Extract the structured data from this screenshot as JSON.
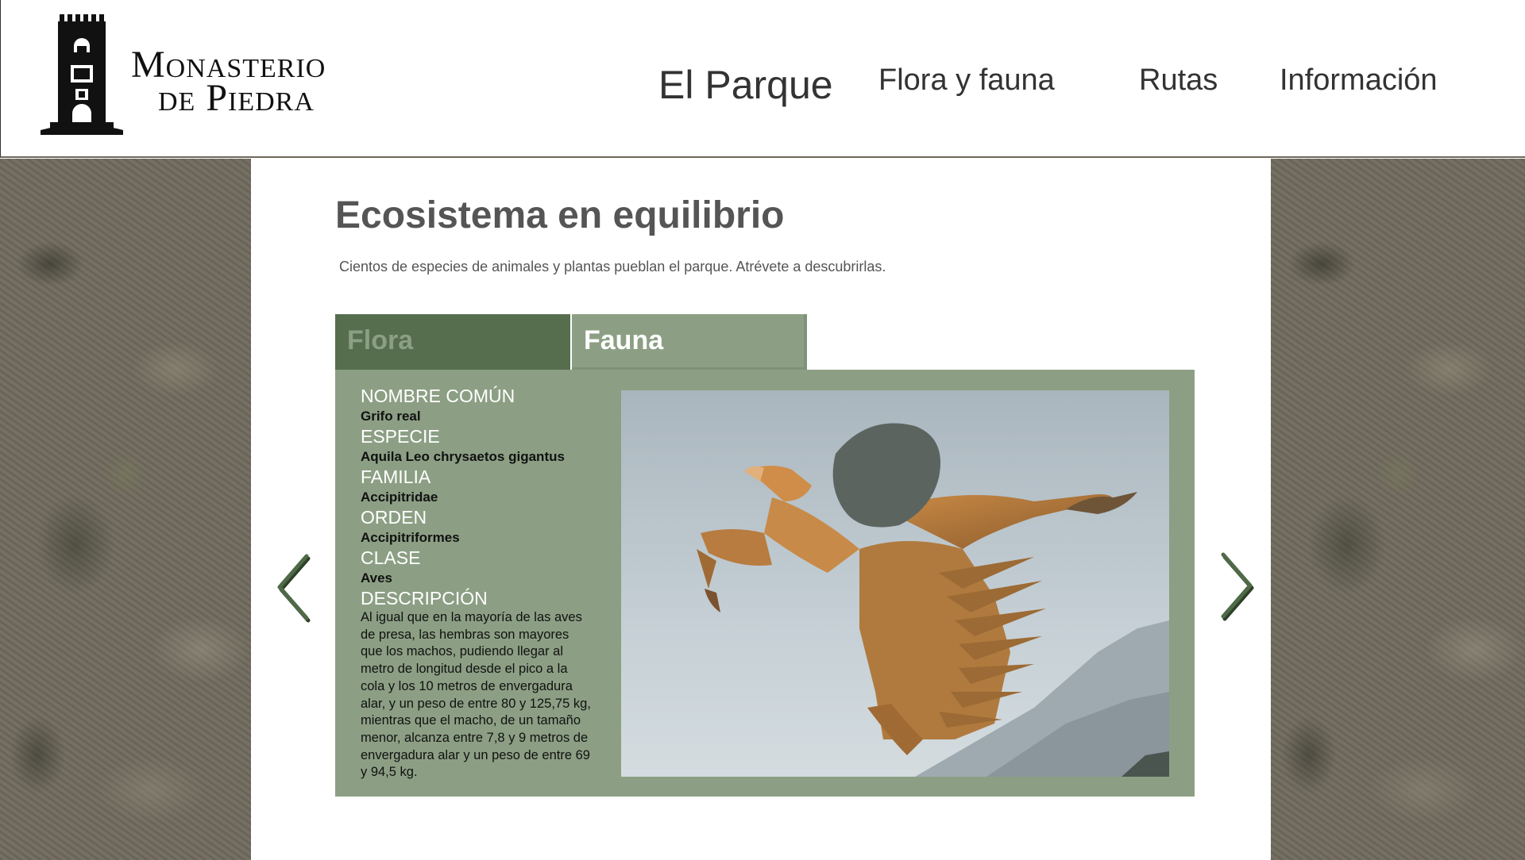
{
  "header": {
    "logo_line1": "Monasterio",
    "logo_line2": "de Piedra",
    "nav": [
      {
        "label": "El Parque"
      },
      {
        "label": "Flora y fauna"
      },
      {
        "label": "Rutas"
      },
      {
        "label": "Información"
      }
    ]
  },
  "main": {
    "title": "Ecosistema en equilibrio",
    "subtitle": "Cientos de especies de animales y plantas pueblan el parque. Atrévete a descubrirlas.",
    "tabs": [
      {
        "label": "Flora",
        "active": false
      },
      {
        "label": "Fauna",
        "active": true
      }
    ],
    "species": {
      "common_name_label": "NOMBRE COMÚN",
      "common_name": "Grifo real",
      "species_label": "ESPECIE",
      "species": "Aquila Leo chrysaetos gigantus",
      "family_label": "FAMILIA",
      "family": "Accipitridae",
      "order_label": "ORDEN",
      "order": "Accipitriformes",
      "class_label": "CLASE",
      "class": "Aves",
      "description_label": "DESCRIPCIÓN",
      "description": "Al igual que en la mayoría de las aves de presa, las hembras son mayores que los machos, pudiendo llegar al metro de longitud desde el pico a la cola y los 10 metros de envergadura alar, y un peso de entre 80 y 125,75 kg, mientras que el macho, de un tamaño menor, alcanza entre 7,8 y 9 metros de envergadura alar y un peso de entre 69 y 94,5 kg."
    }
  },
  "icons": {
    "prev": "chevron-left-icon",
    "next": "chevron-right-icon"
  },
  "colors": {
    "tab_dark": "#566e4d",
    "tab_light": "#8c9f84",
    "arrow": "#4f6a47"
  }
}
